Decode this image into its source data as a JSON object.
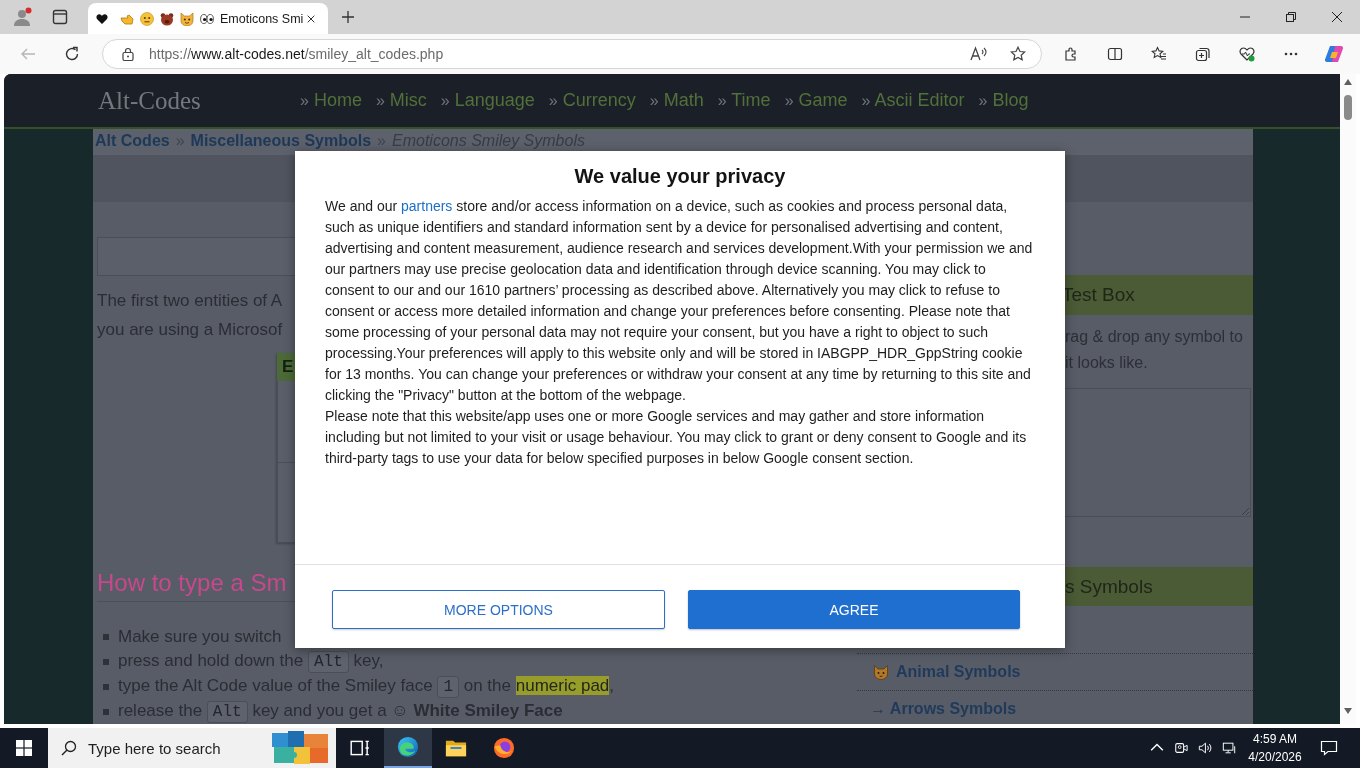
{
  "browser": {
    "tabs": [
      {
        "title": "Emoticons Smi",
        "selected": true
      }
    ],
    "address": {
      "scheme": "https://",
      "host": "www.alt-codes.net",
      "path": "/smiley_alt_codes.php"
    }
  },
  "site": {
    "logo": "Alt-Codes",
    "nav": [
      {
        "mark": "»",
        "label": "Home"
      },
      {
        "mark": "»",
        "label": "Misc"
      },
      {
        "mark": "»",
        "label": "Language"
      },
      {
        "mark": "»",
        "label": "Currency"
      },
      {
        "mark": "»",
        "label": "Math"
      },
      {
        "mark": "»",
        "label": "Time"
      },
      {
        "mark": "»",
        "label": "Game"
      },
      {
        "mark": "»",
        "label": "Ascii Editor"
      },
      {
        "mark": "»",
        "label": "Blog"
      }
    ],
    "breadcrumb": [
      {
        "kind": "link",
        "label": "Alt Codes"
      },
      {
        "kind": "separator",
        "label": "»"
      },
      {
        "kind": "link",
        "label": "Miscellaneous Symbols"
      },
      {
        "kind": "separator",
        "label": "»"
      },
      {
        "kind": "current",
        "label": "Emoticons Smiley Symbols"
      }
    ]
  },
  "article": {
    "intro_lines": [
      "The first two entities of A",
      "you are using a Microsof"
    ],
    "table": {
      "header": "E"
    },
    "heading": "How to type a Sm",
    "steps": [
      [
        {
          "kind": "text",
          "text": "Make sure you switch"
        }
      ],
      [
        {
          "kind": "text",
          "text": "press and hold down the "
        },
        {
          "kind": "key",
          "text": "Alt"
        },
        {
          "kind": "text",
          "text": " key,"
        }
      ],
      [
        {
          "kind": "text",
          "text": "type the Alt Code value of the Smiley face "
        },
        {
          "kind": "key",
          "text": "1"
        },
        {
          "kind": "text",
          "text": " on the "
        },
        {
          "kind": "link",
          "text": "numeric pad"
        },
        {
          "kind": "text",
          "text": ","
        }
      ],
      [
        {
          "kind": "text",
          "text": "release the "
        },
        {
          "kind": "key",
          "text": "Alt"
        },
        {
          "kind": "text",
          "text": " key and you get a ☺ "
        },
        {
          "kind": "bold",
          "text": "White Smiley Face"
        }
      ]
    ]
  },
  "sidebar": {
    "test_box": {
      "title": "Test Box",
      "lines": [
        "rag & drop any symbol to",
        "it looks like."
      ]
    },
    "symbols": {
      "title": "s Symbols",
      "items": [
        {
          "kind": "icon",
          "label": "Animal Symbols"
        },
        {
          "kind": "plain",
          "label": "→ Arrows Symbols"
        }
      ]
    }
  },
  "consent": {
    "title": "We value your privacy",
    "paragraphs": [
      {
        "kind": "linked",
        "before": "We and our",
        "link": "partners",
        "after": "store and/or access information on a device, such as cookies and process personal data, such as unique identifiers and standard information sent by a device for personalised advertising and content, advertising and content measurement, audience research and services development.With your permission we and our partners may use precise geolocation data and identification through device scanning. You may click to consent to our and our 1610 partners’ processing as described above. Alternatively you may click to refuse to consent or access more detailed information and change your preferences before consenting. Please note that some processing of your personal data may not require your consent, but you have a right to object to such processing.Your preferences will apply to this website only and will be stored in IABGPP_HDR_GppString cookie for 13 months. You can change your preferences or withdraw your consent at any time by returning to this site and clicking the \"Privacy\" button at the bottom of the webpage."
      },
      {
        "kind": "plain",
        "text": "Please note that this website/app uses one or more Google services and may gather and store information including but not limited to your visit or usage behaviour. You may click to grant or deny consent to Google and its third-party tags to use your data for below specified purposes in below Google consent section."
      }
    ],
    "buttons": [
      {
        "kind": "secondary",
        "label": "MORE OPTIONS"
      },
      {
        "kind": "primary",
        "label": "AGREE"
      }
    ]
  },
  "taskbar": {
    "search": {
      "placeholder": "Type here to search"
    },
    "apps": [
      {
        "kind": "taskview",
        "selected": false
      },
      {
        "kind": "edge",
        "selected": true
      },
      {
        "kind": "folder",
        "selected": false
      },
      {
        "kind": "firefox",
        "selected": false
      }
    ],
    "clock": {
      "time": "4:59 AM",
      "date": "4/20/2026"
    }
  }
}
